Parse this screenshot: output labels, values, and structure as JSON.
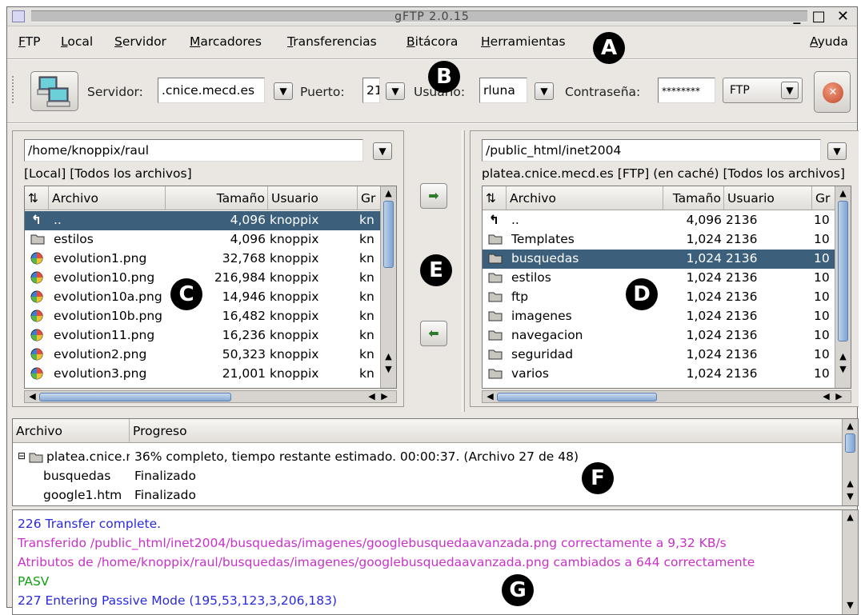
{
  "window": {
    "title": "gFTP 2.0.15",
    "controls": "_ □ ✕"
  },
  "menu": [
    "FTP",
    "Local",
    "Servidor",
    "Marcadores",
    "Transferencias",
    "Bitácora",
    "Herramientas"
  ],
  "menu_help": "Ayuda",
  "toolbar": {
    "server_label": "Servidor:",
    "server_value": ".cnice.mecd.es",
    "port_label": "Puerto:",
    "port_value": "21",
    "user_label": "Usuario:",
    "user_value": "rluna",
    "password_label": "Contraseña:",
    "password_value": "********",
    "protocol_value": "FTP"
  },
  "local": {
    "path": "/home/knoppix/raul",
    "status": "[Local] [Todos los archivos]",
    "columns": [
      "Archivo",
      "Tamaño",
      "Usuario",
      "Gr"
    ],
    "rows": [
      {
        "name": "..",
        "size": "4,096",
        "user": "knoppix",
        "group": "kn",
        "icon": "up-dir-icon"
      },
      {
        "name": "estilos",
        "size": "4,096",
        "user": "knoppix",
        "group": "kn",
        "icon": "folder-icon"
      },
      {
        "name": "evolution1.png",
        "size": "32,768",
        "user": "knoppix",
        "group": "kn",
        "icon": "image-file-icon"
      },
      {
        "name": "evolution10.png",
        "size": "216,984",
        "user": "knoppix",
        "group": "kn",
        "icon": "image-file-icon"
      },
      {
        "name": "evolution10a.png",
        "size": "14,946",
        "user": "knoppix",
        "group": "kn",
        "icon": "image-file-icon"
      },
      {
        "name": "evolution10b.png",
        "size": "16,482",
        "user": "knoppix",
        "group": "kn",
        "icon": "image-file-icon"
      },
      {
        "name": "evolution11.png",
        "size": "16,236",
        "user": "knoppix",
        "group": "kn",
        "icon": "image-file-icon"
      },
      {
        "name": "evolution2.png",
        "size": "50,323",
        "user": "knoppix",
        "group": "kn",
        "icon": "image-file-icon"
      },
      {
        "name": "evolution3.png",
        "size": "21,001",
        "user": "knoppix",
        "group": "kn",
        "icon": "image-file-icon"
      }
    ]
  },
  "remote": {
    "path": "/public_html/inet2004",
    "status": "platea.cnice.mecd.es [FTP] (en caché) [Todos los archivos]",
    "columns": [
      "Archivo",
      "Tamaño",
      "Usuario",
      "Gr"
    ],
    "rows": [
      {
        "name": "..",
        "size": "4,096",
        "user": "2136",
        "group": "10",
        "icon": "up-dir-icon"
      },
      {
        "name": "Templates",
        "size": "1,024",
        "user": "2136",
        "group": "10",
        "icon": "folder-icon"
      },
      {
        "name": "busquedas",
        "size": "1,024",
        "user": "2136",
        "group": "10",
        "icon": "folder-icon"
      },
      {
        "name": "estilos",
        "size": "1,024",
        "user": "2136",
        "group": "10",
        "icon": "folder-icon"
      },
      {
        "name": "ftp",
        "size": "1,024",
        "user": "2136",
        "group": "10",
        "icon": "folder-icon"
      },
      {
        "name": "imagenes",
        "size": "1,024",
        "user": "2136",
        "group": "10",
        "icon": "folder-icon"
      },
      {
        "name": "navegacion",
        "size": "1,024",
        "user": "2136",
        "group": "10",
        "icon": "folder-icon"
      },
      {
        "name": "seguridad",
        "size": "1,024",
        "user": "2136",
        "group": "10",
        "icon": "folder-icon"
      },
      {
        "name": "varios",
        "size": "1,024",
        "user": "2136",
        "group": "10",
        "icon": "folder-icon"
      }
    ]
  },
  "queue": {
    "columns": [
      "Archivo",
      "Progreso"
    ],
    "rows": [
      {
        "file": "platea.cnice.mecd.es",
        "progress": "36% completo, tiempo restante estimado. 00:00:37. (Archivo 27 de 48)"
      },
      {
        "file": "busquedas",
        "progress": "Finalizado"
      },
      {
        "file": "google1.htm",
        "progress": "Finalizado"
      }
    ]
  },
  "log": [
    {
      "text": "226 Transfer complete.",
      "color": "#2a2ae0"
    },
    {
      "text": "Transferido /public_html/inet2004/busquedas/imagenes/googlebusquedaavanzada.png correctamente a 9,32 KB/s",
      "color": "#c832c8"
    },
    {
      "text": "Atributos de /home/knoppix/raul/busquedas/imagenes/googlebusquedaavanzada.png cambiados a 644 correctamente",
      "color": "#c832c8"
    },
    {
      "text": "PASV",
      "color": "#14a014"
    },
    {
      "text": "227 Entering Passive Mode (195,53,123,3,206,183)",
      "color": "#2a2ae0"
    }
  ],
  "annotations": [
    "A",
    "B",
    "C",
    "D",
    "E",
    "F",
    "G"
  ],
  "colors": {
    "selection": "#3c5f7b",
    "window_bg": "#eae7e2",
    "scroll_thumb": "#7da4d2"
  }
}
